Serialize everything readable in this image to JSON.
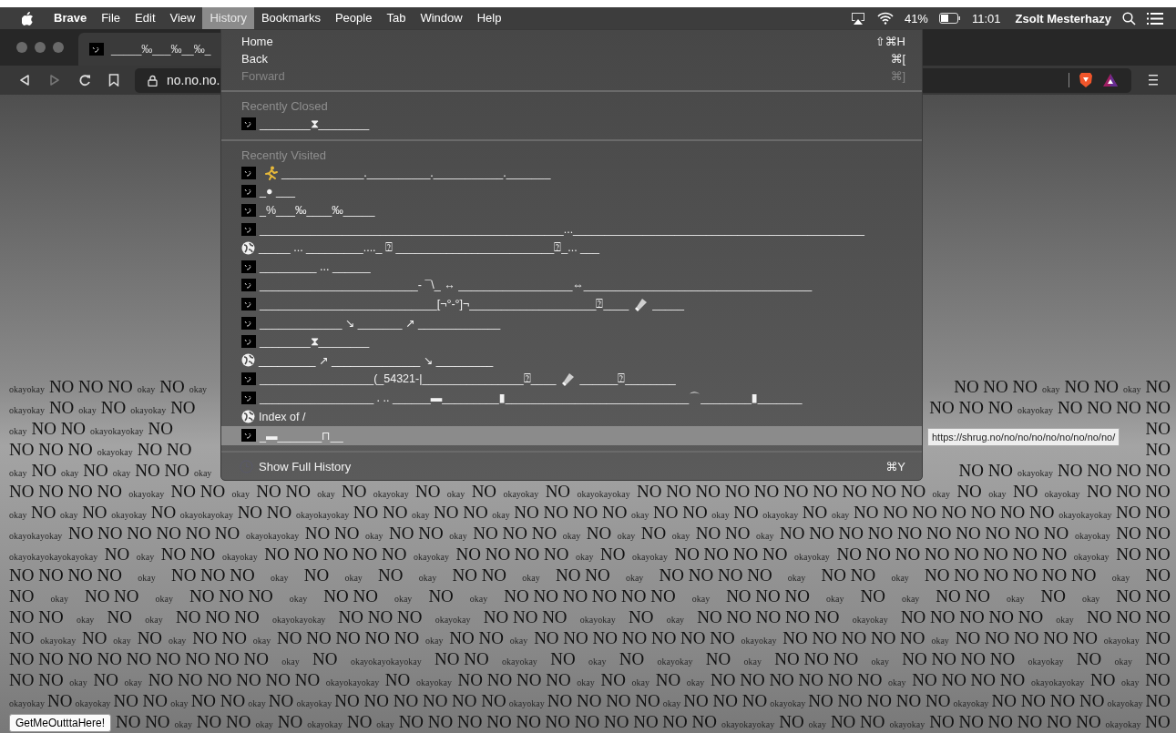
{
  "menu_bar": {
    "app": "Brave",
    "items": [
      {
        "label": "File",
        "selected": false
      },
      {
        "label": "Edit",
        "selected": false
      },
      {
        "label": "View",
        "selected": false
      },
      {
        "label": "History",
        "selected": true
      },
      {
        "label": "Bookmarks",
        "selected": false
      },
      {
        "label": "People",
        "selected": false
      },
      {
        "label": "Tab",
        "selected": false
      },
      {
        "label": "Window",
        "selected": false
      },
      {
        "label": "Help",
        "selected": false
      }
    ],
    "battery": "41%",
    "time": "11:01",
    "user": "Zsolt Mesterhazy"
  },
  "tab": {
    "title": "_____‰___‰__‰_"
  },
  "toolbar": {
    "forward_disabled": true,
    "address": "no.no.no."
  },
  "history_menu": {
    "items": [
      {
        "kind": "command",
        "label": "Home",
        "shortcut": "⇧⌘H",
        "disabled": false
      },
      {
        "kind": "command",
        "label": "Back",
        "shortcut": "⌘[",
        "disabled": false
      },
      {
        "kind": "command",
        "label": "Forward",
        "shortcut": "⌘]",
        "disabled": true
      },
      {
        "kind": "separator"
      },
      {
        "kind": "header",
        "label": "Recently Closed"
      },
      {
        "kind": "entry",
        "selected": false,
        "segments": [
          {
            "kind": "text",
            "text": "________⧗________"
          }
        ]
      },
      {
        "kind": "separator"
      },
      {
        "kind": "header",
        "label": "Recently Visited"
      },
      {
        "kind": "entry",
        "selected": false,
        "segments": [
          {
            "kind": "runner"
          },
          {
            "kind": "text",
            "text": "_____________.__________.___________._______"
          }
        ]
      },
      {
        "kind": "entry",
        "selected": false,
        "segments": [
          {
            "kind": "text",
            "text": "_● ___"
          }
        ]
      },
      {
        "kind": "entry",
        "selected": false,
        "segments": [
          {
            "kind": "text",
            "text": "_%___‰____‰_____"
          }
        ]
      },
      {
        "kind": "entry",
        "selected": false,
        "segments": [
          {
            "kind": "text",
            "text": "________________________________________________...______________________________________________"
          }
        ]
      },
      {
        "kind": "globe_entry",
        "selected": false,
        "segments": [
          {
            "kind": "text",
            "text": "_____ ... _________...._ ⍰ _________________________⍰_... ___"
          }
        ]
      },
      {
        "kind": "entry",
        "selected": false,
        "segments": [
          {
            "kind": "text",
            "text": "_________ ... ______"
          }
        ]
      },
      {
        "kind": "entry",
        "selected": false,
        "segments": [
          {
            "kind": "text",
            "text": "_________________________- ¯\\_ ↔ __________________⇔____________________________________"
          }
        ]
      },
      {
        "kind": "entry",
        "selected": false,
        "segments": [
          {
            "kind": "text",
            "text": "____________________________[¬°-°]¬____________________⍰____"
          },
          {
            "kind": "flashlight"
          },
          {
            "kind": "text",
            "text": "_____"
          }
        ]
      },
      {
        "kind": "entry",
        "selected": false,
        "segments": [
          {
            "kind": "text",
            "text": "_____________ ↘ _______ ↗ _____________"
          }
        ]
      },
      {
        "kind": "entry",
        "selected": false,
        "segments": [
          {
            "kind": "text",
            "text": "________⧗________"
          }
        ]
      },
      {
        "kind": "globe_entry",
        "selected": false,
        "segments": [
          {
            "kind": "text",
            "text": "_________ ↗ ______________ ↘ _________"
          }
        ]
      },
      {
        "kind": "entry",
        "selected": false,
        "segments": [
          {
            "kind": "text",
            "text": "__________________(_54321-|________________⍰____"
          },
          {
            "kind": "flashlight"
          },
          {
            "kind": "text",
            "text": "______⍰________"
          }
        ]
      },
      {
        "kind": "entry",
        "selected": false,
        "segments": [
          {
            "kind": "text",
            "text": "__________________ . .. ______▬_________▮_____________________________⌒________▮_______"
          }
        ]
      },
      {
        "kind": "globe_entry",
        "selected": false,
        "segments": [
          {
            "kind": "text",
            "text": "Index of /"
          }
        ]
      },
      {
        "kind": "entry",
        "selected": true,
        "segments": [
          {
            "kind": "text",
            "text": "_▬_______⊓__"
          }
        ]
      },
      {
        "kind": "separator"
      },
      {
        "kind": "history_command",
        "label": "Show Full History",
        "shortcut": "⌘Y",
        "disabled": false
      }
    ]
  },
  "tooltip": "https://shrug.no/no/no/no/no/no/no/no/no/",
  "page": {
    "button": "GetMeOutttaHere!",
    "rows": [
      {
        "left": [
          {
            "kind": "small",
            "text": "okayokay"
          },
          {
            "kind": "big",
            "text": "NO NO NO"
          },
          {
            "kind": "small",
            "text": "okay"
          },
          {
            "kind": "big",
            "text": "NO"
          },
          {
            "kind": "small",
            "text": "okay"
          }
        ],
        "right": [
          {
            "kind": "big",
            "text": "NO NO NO"
          },
          {
            "kind": "small",
            "text": "okay"
          },
          {
            "kind": "big",
            "text": "NO NO"
          },
          {
            "kind": "small",
            "text": "okay"
          },
          {
            "kind": "big",
            "text": "NO"
          }
        ]
      },
      {
        "left": [
          {
            "kind": "small",
            "text": "okayokay"
          },
          {
            "kind": "big",
            "text": "NO"
          },
          {
            "kind": "small",
            "text": "okay"
          },
          {
            "kind": "big",
            "text": "NO"
          },
          {
            "kind": "small",
            "text": "okayokay"
          },
          {
            "kind": "big",
            "text": "NO"
          }
        ],
        "right": [
          {
            "kind": "big",
            "text": "NO NO NO"
          },
          {
            "kind": "small",
            "text": "okayokay"
          },
          {
            "kind": "big",
            "text": "NO NO NO NO"
          }
        ]
      },
      {
        "left": [
          {
            "kind": "small",
            "text": "okay"
          },
          {
            "kind": "big",
            "text": "NO NO"
          },
          {
            "kind": "small",
            "text": "okayokayokay"
          },
          {
            "kind": "big",
            "text": "NO"
          }
        ],
        "right": [
          {
            "kind": "big",
            "text": "NO"
          }
        ]
      },
      {
        "left": [
          {
            "kind": "big",
            "text": "NO NO NO"
          },
          {
            "kind": "small",
            "text": "okayokay"
          },
          {
            "kind": "big",
            "text": "NO NO"
          }
        ],
        "right": [
          {
            "kind": "big",
            "text": "NO"
          }
        ]
      },
      {
        "left": [
          {
            "kind": "small",
            "text": "okay"
          },
          {
            "kind": "big",
            "text": "NO"
          },
          {
            "kind": "small",
            "text": "okay"
          },
          {
            "kind": "big",
            "text": "NO"
          },
          {
            "kind": "small",
            "text": "okay"
          },
          {
            "kind": "big",
            "text": "NO NO"
          },
          {
            "kind": "small",
            "text": "okay"
          }
        ],
        "right": [
          {
            "kind": "big",
            "text": "NO NO"
          },
          {
            "kind": "small",
            "text": "okayokay"
          },
          {
            "kind": "big",
            "text": "NO NO NO NO"
          }
        ]
      },
      {
        "segments": [
          {
            "kind": "big",
            "text": "NO NO NO NO"
          },
          {
            "kind": "small",
            "text": "okayokay"
          },
          {
            "kind": "big",
            "text": "NO NO"
          },
          {
            "kind": "small",
            "text": "okay"
          },
          {
            "kind": "big",
            "text": "NO NO"
          },
          {
            "kind": "small",
            "text": "okay"
          },
          {
            "kind": "big",
            "text": "NO"
          },
          {
            "kind": "small",
            "text": "okayokay"
          },
          {
            "kind": "big",
            "text": "NO"
          },
          {
            "kind": "small",
            "text": "okay"
          },
          {
            "kind": "big",
            "text": "NO"
          },
          {
            "kind": "small",
            "text": "okayokay"
          },
          {
            "kind": "big",
            "text": "NO"
          },
          {
            "kind": "small",
            "text": "okayokayokay"
          },
          {
            "kind": "big",
            "text": "NO NO NO NO NO NO NO NO NO NO"
          },
          {
            "kind": "small",
            "text": "okay"
          },
          {
            "kind": "big",
            "text": "NO"
          },
          {
            "kind": "small",
            "text": "okay"
          },
          {
            "kind": "big",
            "text": "NO"
          },
          {
            "kind": "small",
            "text": "okayokay"
          },
          {
            "kind": "big",
            "text": "NO NO NO"
          }
        ]
      },
      {
        "segments": [
          {
            "kind": "small",
            "text": "okay"
          },
          {
            "kind": "big",
            "text": "NO"
          },
          {
            "kind": "small",
            "text": "okay"
          },
          {
            "kind": "big",
            "text": "NO"
          },
          {
            "kind": "small",
            "text": "okayokay"
          },
          {
            "kind": "big",
            "text": "NO"
          },
          {
            "kind": "small",
            "text": "okayokayokay"
          },
          {
            "kind": "big",
            "text": "NO NO"
          },
          {
            "kind": "small",
            "text": "okayokayokay"
          },
          {
            "kind": "big",
            "text": "NO NO"
          },
          {
            "kind": "small",
            "text": "okay"
          },
          {
            "kind": "big",
            "text": "NO NO"
          },
          {
            "kind": "small",
            "text": "okay"
          },
          {
            "kind": "big",
            "text": "NO NO NO NO"
          },
          {
            "kind": "small",
            "text": "okay"
          },
          {
            "kind": "big",
            "text": "NO NO"
          },
          {
            "kind": "small",
            "text": "okay"
          },
          {
            "kind": "big",
            "text": "NO"
          },
          {
            "kind": "small",
            "text": "okayokay"
          },
          {
            "kind": "big",
            "text": "NO"
          },
          {
            "kind": "small",
            "text": "okay"
          },
          {
            "kind": "big",
            "text": "NO NO NO NO NO NO NO"
          },
          {
            "kind": "small",
            "text": "okayokayokay"
          },
          {
            "kind": "big",
            "text": "NO NO"
          }
        ]
      },
      {
        "segments": [
          {
            "kind": "small",
            "text": "okayokayokay"
          },
          {
            "kind": "big",
            "text": "NO NO NO NO NO NO"
          },
          {
            "kind": "small",
            "text": "okayokayokay"
          },
          {
            "kind": "big",
            "text": "NO NO"
          },
          {
            "kind": "small",
            "text": "okay"
          },
          {
            "kind": "big",
            "text": "NO NO"
          },
          {
            "kind": "small",
            "text": "okay"
          },
          {
            "kind": "big",
            "text": "NO NO NO"
          },
          {
            "kind": "small",
            "text": "okay"
          },
          {
            "kind": "big",
            "text": "NO"
          },
          {
            "kind": "small",
            "text": "okay"
          },
          {
            "kind": "big",
            "text": "NO"
          },
          {
            "kind": "small",
            "text": "okay"
          },
          {
            "kind": "big",
            "text": "NO NO"
          },
          {
            "kind": "small",
            "text": "okay"
          },
          {
            "kind": "big",
            "text": "NO NO NO NO NO NO NO NO NO NO"
          },
          {
            "kind": "small",
            "text": "okayokay"
          },
          {
            "kind": "big",
            "text": "NO NO"
          }
        ]
      },
      {
        "segments": [
          {
            "kind": "small",
            "text": "okayokayokayokayokay"
          },
          {
            "kind": "big",
            "text": "NO"
          },
          {
            "kind": "small",
            "text": "okay"
          },
          {
            "kind": "big",
            "text": "NO NO"
          },
          {
            "kind": "small",
            "text": "okayokay"
          },
          {
            "kind": "big",
            "text": "NO NO NO NO NO"
          },
          {
            "kind": "small",
            "text": "okayokay"
          },
          {
            "kind": "big",
            "text": "NO NO NO NO"
          },
          {
            "kind": "small",
            "text": "okay"
          },
          {
            "kind": "big",
            "text": "NO"
          },
          {
            "kind": "small",
            "text": "okayokay"
          },
          {
            "kind": "big",
            "text": "NO NO NO NO"
          },
          {
            "kind": "small",
            "text": "okayokay"
          },
          {
            "kind": "big",
            "text": "NO NO NO NO NO NO NO NO"
          },
          {
            "kind": "small",
            "text": "okayokay"
          },
          {
            "kind": "big",
            "text": "NO NO"
          }
        ]
      },
      {
        "segments": [
          {
            "kind": "big",
            "text": "NO NO NO NO"
          },
          {
            "kind": "small",
            "text": "okay"
          },
          {
            "kind": "big",
            "text": "NO NO NO"
          },
          {
            "kind": "small",
            "text": "okay"
          },
          {
            "kind": "big",
            "text": "NO"
          },
          {
            "kind": "small",
            "text": "okay"
          },
          {
            "kind": "big",
            "text": "NO"
          },
          {
            "kind": "small",
            "text": "okay"
          },
          {
            "kind": "big",
            "text": "NO NO"
          },
          {
            "kind": "small",
            "text": "okay"
          },
          {
            "kind": "big",
            "text": "NO NO"
          },
          {
            "kind": "small",
            "text": "okay"
          },
          {
            "kind": "big",
            "text": "NO NO NO NO"
          },
          {
            "kind": "small",
            "text": "okay"
          },
          {
            "kind": "big",
            "text": "NO NO"
          },
          {
            "kind": "small",
            "text": "okay"
          },
          {
            "kind": "big",
            "text": "NO NO NO NO NO NO"
          },
          {
            "kind": "small",
            "text": "okay"
          },
          {
            "kind": "big",
            "text": "NO"
          }
        ]
      },
      {
        "segments": [
          {
            "kind": "big",
            "text": "NO"
          },
          {
            "kind": "small",
            "text": "okay"
          },
          {
            "kind": "big",
            "text": "NO NO"
          },
          {
            "kind": "small",
            "text": "okay"
          },
          {
            "kind": "big",
            "text": "NO NO NO"
          },
          {
            "kind": "small",
            "text": "okay"
          },
          {
            "kind": "big",
            "text": "NO NO"
          },
          {
            "kind": "small",
            "text": "okay"
          },
          {
            "kind": "big",
            "text": "NO"
          },
          {
            "kind": "small",
            "text": "okay"
          },
          {
            "kind": "big",
            "text": "NO NO NO NO NO NO"
          },
          {
            "kind": "small",
            "text": "okay"
          },
          {
            "kind": "big",
            "text": "NO NO NO"
          },
          {
            "kind": "small",
            "text": "okay"
          },
          {
            "kind": "big",
            "text": "NO"
          },
          {
            "kind": "small",
            "text": "okay"
          },
          {
            "kind": "big",
            "text": "NO NO"
          },
          {
            "kind": "small",
            "text": "okay"
          },
          {
            "kind": "big",
            "text": "NO"
          },
          {
            "kind": "small",
            "text": "okay"
          },
          {
            "kind": "big",
            "text": "NO NO"
          }
        ]
      },
      {
        "segments": [
          {
            "kind": "big",
            "text": "NO NO"
          },
          {
            "kind": "small",
            "text": "okay"
          },
          {
            "kind": "big",
            "text": "NO"
          },
          {
            "kind": "small",
            "text": "okay"
          },
          {
            "kind": "big",
            "text": "NO NO NO"
          },
          {
            "kind": "small",
            "text": "okayokayokay"
          },
          {
            "kind": "big",
            "text": "NO NO NO"
          },
          {
            "kind": "small",
            "text": "okayokay"
          },
          {
            "kind": "big",
            "text": "NO NO NO"
          },
          {
            "kind": "small",
            "text": "okayokay"
          },
          {
            "kind": "big",
            "text": "NO"
          },
          {
            "kind": "small",
            "text": "okay"
          },
          {
            "kind": "big",
            "text": "NO NO NO NO NO"
          },
          {
            "kind": "small",
            "text": "okayokay"
          },
          {
            "kind": "big",
            "text": "NO NO NO NO NO"
          },
          {
            "kind": "small",
            "text": "okay"
          },
          {
            "kind": "big",
            "text": "NO NO NO"
          }
        ]
      },
      {
        "segments": [
          {
            "kind": "big",
            "text": "NO"
          },
          {
            "kind": "small",
            "text": "okayokay"
          },
          {
            "kind": "big",
            "text": "NO"
          },
          {
            "kind": "small",
            "text": "okay"
          },
          {
            "kind": "big",
            "text": "NO"
          },
          {
            "kind": "small",
            "text": "okay"
          },
          {
            "kind": "big",
            "text": "NO NO"
          },
          {
            "kind": "small",
            "text": "okay"
          },
          {
            "kind": "big",
            "text": "NO NO NO NO NO"
          },
          {
            "kind": "small",
            "text": "okay"
          },
          {
            "kind": "big",
            "text": "NO NO"
          },
          {
            "kind": "small",
            "text": "okay"
          },
          {
            "kind": "big",
            "text": "NO NO NO NO NO NO NO"
          },
          {
            "kind": "small",
            "text": "okayokay"
          },
          {
            "kind": "big",
            "text": "NO NO NO NO NO"
          },
          {
            "kind": "small",
            "text": "okay"
          },
          {
            "kind": "big",
            "text": "NO NO NO NO NO"
          },
          {
            "kind": "small",
            "text": "okayokay"
          },
          {
            "kind": "big",
            "text": "NO"
          }
        ]
      },
      {
        "segments": [
          {
            "kind": "big",
            "text": "NO NO NO NO NO NO NO NO NO"
          },
          {
            "kind": "small",
            "text": "okay"
          },
          {
            "kind": "big",
            "text": "NO"
          },
          {
            "kind": "small",
            "text": "okayokayokayokay"
          },
          {
            "kind": "big",
            "text": "NO NO"
          },
          {
            "kind": "small",
            "text": "okayokay"
          },
          {
            "kind": "big",
            "text": "NO"
          },
          {
            "kind": "small",
            "text": "okay"
          },
          {
            "kind": "big",
            "text": "NO"
          },
          {
            "kind": "small",
            "text": "okayokay"
          },
          {
            "kind": "big",
            "text": "NO"
          },
          {
            "kind": "small",
            "text": "okay"
          },
          {
            "kind": "big",
            "text": "NO NO NO"
          },
          {
            "kind": "small",
            "text": "okay"
          },
          {
            "kind": "big",
            "text": "NO NO NO NO"
          },
          {
            "kind": "small",
            "text": "okayokay"
          },
          {
            "kind": "big",
            "text": "NO"
          },
          {
            "kind": "small",
            "text": "okay"
          },
          {
            "kind": "big",
            "text": "NO"
          }
        ]
      },
      {
        "segments": [
          {
            "kind": "big",
            "text": "NO NO"
          },
          {
            "kind": "small",
            "text": "okay"
          },
          {
            "kind": "big",
            "text": "NO"
          },
          {
            "kind": "small",
            "text": "okay"
          },
          {
            "kind": "big",
            "text": "NO NO NO NO NO NO"
          },
          {
            "kind": "small",
            "text": "okayokayokay"
          },
          {
            "kind": "big",
            "text": "NO"
          },
          {
            "kind": "small",
            "text": "okayokay"
          },
          {
            "kind": "big",
            "text": "NO NO NO NO"
          },
          {
            "kind": "small",
            "text": "okay"
          },
          {
            "kind": "big",
            "text": "NO"
          },
          {
            "kind": "small",
            "text": "okay"
          },
          {
            "kind": "big",
            "text": "NO"
          },
          {
            "kind": "small",
            "text": "okay"
          },
          {
            "kind": "big",
            "text": "NO NO NO NO NO NO"
          },
          {
            "kind": "small",
            "text": "okay"
          },
          {
            "kind": "big",
            "text": "NO NO NO NO"
          },
          {
            "kind": "small",
            "text": "okayokayokay"
          },
          {
            "kind": "big",
            "text": "NO"
          },
          {
            "kind": "small",
            "text": "okay"
          },
          {
            "kind": "big",
            "text": "NO"
          }
        ]
      },
      {
        "segments": [
          {
            "kind": "small",
            "text": "okayokay"
          },
          {
            "kind": "big",
            "text": "NO"
          },
          {
            "kind": "small",
            "text": "okayokay"
          },
          {
            "kind": "big",
            "text": "NO NO"
          },
          {
            "kind": "small",
            "text": "okay"
          },
          {
            "kind": "big",
            "text": "NO NO"
          },
          {
            "kind": "small",
            "text": "okay"
          },
          {
            "kind": "big",
            "text": "NO"
          },
          {
            "kind": "small",
            "text": "okayokay"
          },
          {
            "kind": "big",
            "text": "NO NO NO NO NO NO"
          },
          {
            "kind": "small",
            "text": "okayokay"
          },
          {
            "kind": "big",
            "text": "NO NO NO NO"
          },
          {
            "kind": "small",
            "text": "okay"
          },
          {
            "kind": "big",
            "text": "NO NO NO"
          },
          {
            "kind": "small",
            "text": "okayokay"
          },
          {
            "kind": "big",
            "text": "NO NO NO NO NO"
          },
          {
            "kind": "small",
            "text": "okayokay"
          },
          {
            "kind": "big",
            "text": "NO NO NO NO"
          },
          {
            "kind": "small",
            "text": "okayokay"
          },
          {
            "kind": "big",
            "text": "NO"
          }
        ]
      },
      {
        "segments": [
          {
            "kind": "big",
            "text": "NO NO"
          },
          {
            "kind": "small",
            "text": "okay"
          },
          {
            "kind": "big",
            "text": "NO NO"
          },
          {
            "kind": "small",
            "text": "okay"
          },
          {
            "kind": "big",
            "text": "NO"
          },
          {
            "kind": "small",
            "text": "okayokay"
          },
          {
            "kind": "big",
            "text": "NO"
          },
          {
            "kind": "small",
            "text": "okay"
          },
          {
            "kind": "big",
            "text": "NO NO NO NO NO NO NO NO NO NO NO"
          },
          {
            "kind": "small",
            "text": "okayokayokay"
          },
          {
            "kind": "big",
            "text": "NO"
          },
          {
            "kind": "small",
            "text": "okay"
          },
          {
            "kind": "big",
            "text": "NO NO"
          },
          {
            "kind": "small",
            "text": "okayokay"
          },
          {
            "kind": "big",
            "text": "NO NO NO NO NO NO"
          },
          {
            "kind": "small",
            "text": "okayokay"
          },
          {
            "kind": "big",
            "text": "NO"
          }
        ]
      }
    ]
  }
}
